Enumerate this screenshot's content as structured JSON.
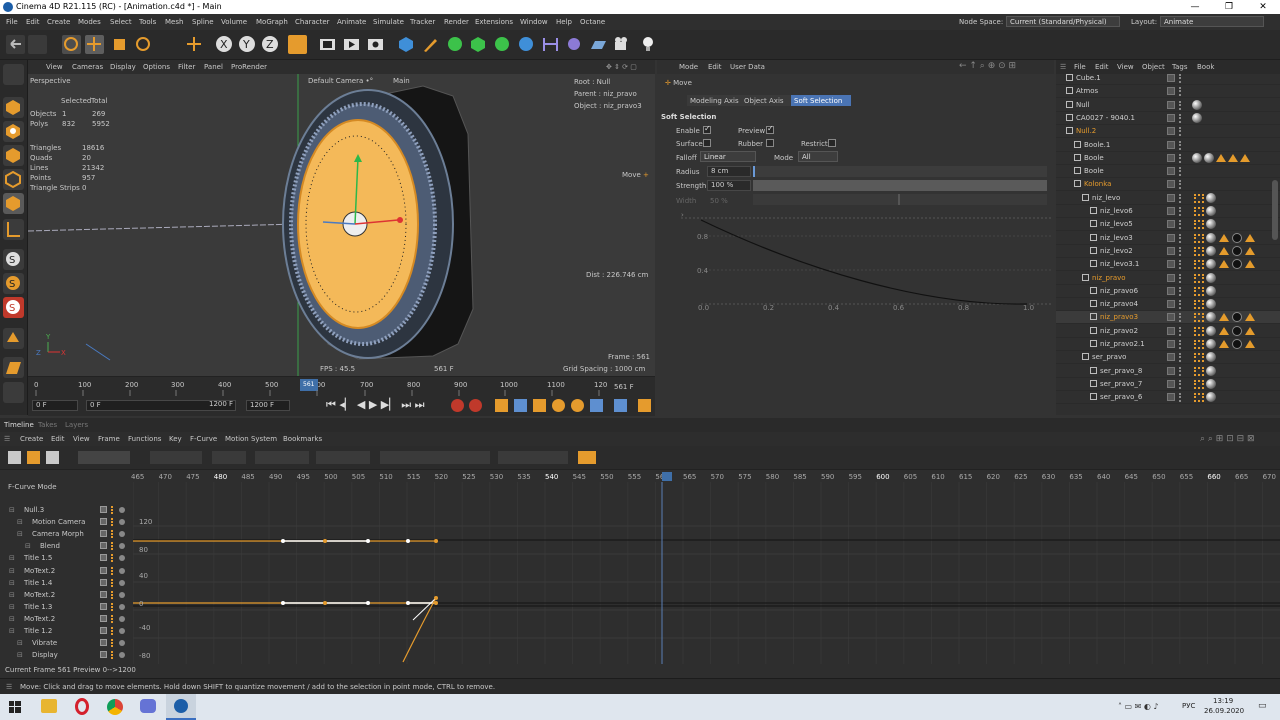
{
  "window": {
    "title": "Cinema 4D R21.115 (RC) - [Animation.c4d *] - Main"
  },
  "menubar": {
    "items": [
      "File",
      "Edit",
      "Create",
      "Modes",
      "Select",
      "Tools",
      "Mesh",
      "Spline",
      "Volume",
      "MoGraph",
      "Character",
      "Animate",
      "Simulate",
      "Tracker",
      "Render",
      "Extensions",
      "Window",
      "Help",
      "Octane"
    ],
    "node_space_label": "Node Space:",
    "node_space_value": "Current (Standard/Physical)",
    "layout_label": "Layout:",
    "layout_value": "Animate"
  },
  "viewport": {
    "menu": [
      "View",
      "Cameras",
      "Display",
      "Options",
      "Filter",
      "Panel",
      "ProRender"
    ],
    "name": "Perspective",
    "camera": "Default Camera",
    "camera_icon": "•°",
    "main": "Main",
    "stats_header": [
      "Selected",
      "Total"
    ],
    "stats": [
      {
        "k": "Objects",
        "a": "1",
        "b": "269"
      },
      {
        "k": "Polys",
        "a": "832",
        "b": "5952"
      }
    ],
    "stats2": [
      {
        "k": "Triangles",
        "v": "18616"
      },
      {
        "k": "Quads",
        "v": "20"
      },
      {
        "k": "Lines",
        "v": "21342"
      },
      {
        "k": "Points",
        "v": "957"
      },
      {
        "k": "Triangle Strips",
        "v": "0"
      }
    ],
    "root": "Root : Null",
    "parent": "Parent : niz_pravo",
    "object": "Object : niz_pravo3",
    "move": "Move",
    "dist": "Dist : 226.746 cm",
    "fps": "FPS : 45.5",
    "frame_mid": "561 F",
    "frame": "Frame : 561",
    "grid": "Grid Spacing : 1000 cm"
  },
  "ruler": {
    "ticks": [
      "0",
      "100",
      "200",
      "300",
      "400",
      "500",
      "600",
      "700",
      "800",
      "900",
      "1000",
      "1100",
      "120"
    ],
    "current": "561 F",
    "cursor": "561"
  },
  "playbar": {
    "start": "0 F",
    "current": "0 F",
    "end": "1200 F",
    "end2": "1200 F"
  },
  "attr": {
    "menu": [
      "Mode",
      "Edit",
      "User Data"
    ],
    "tool": "Move",
    "tabs": [
      "Modeling Axis",
      "Object Axis",
      "Soft Selection"
    ],
    "section": "Soft Selection",
    "enable": "Enable",
    "preview": "Preview",
    "surface": "Surface",
    "rubber": "Rubber",
    "restrict": "Restrict",
    "falloff_label": "Falloff",
    "falloff_value": "Linear",
    "mode_label": "Mode",
    "mode_value": "All",
    "radius_label": "Radius",
    "radius_value": "8 cm",
    "strength_label": "Strength",
    "strength_value": "100 %",
    "width_label": "Width",
    "width_value": "50 %",
    "curve_y": [
      "0.8",
      "0.4"
    ],
    "curve_x": [
      "0.0",
      "0.2",
      "0.4",
      "0.6",
      "0.8",
      "1.0"
    ]
  },
  "objects": {
    "menu": [
      "File",
      "Edit",
      "View",
      "Object",
      "Tags",
      "Book"
    ],
    "rows": [
      {
        "name": "Cube.1",
        "depth": 0
      },
      {
        "name": "Atmos",
        "depth": 0
      },
      {
        "name": "Null",
        "depth": 0
      },
      {
        "name": "CA0027 - 9040.1",
        "depth": 0
      },
      {
        "name": "Null.2",
        "depth": 0,
        "orange": true
      },
      {
        "name": "Boole.1",
        "depth": 1
      },
      {
        "name": "Boole",
        "depth": 1
      },
      {
        "name": "Boole",
        "depth": 1
      },
      {
        "name": "Kolonka",
        "depth": 1,
        "orange": true
      },
      {
        "name": "niz_levo",
        "depth": 2
      },
      {
        "name": "niz_levo6",
        "depth": 3
      },
      {
        "name": "niz_levo5",
        "depth": 3
      },
      {
        "name": "niz_levo3",
        "depth": 3
      },
      {
        "name": "niz_levo2",
        "depth": 3
      },
      {
        "name": "niz_levo3.1",
        "depth": 3
      },
      {
        "name": "niz_pravo",
        "depth": 2,
        "orange": true
      },
      {
        "name": "niz_pravo6",
        "depth": 3
      },
      {
        "name": "niz_pravo4",
        "depth": 3
      },
      {
        "name": "niz_pravo3",
        "depth": 3,
        "orange": true,
        "selected": true
      },
      {
        "name": "niz_pravo2",
        "depth": 3
      },
      {
        "name": "niz_pravo2.1",
        "depth": 3
      },
      {
        "name": "ser_pravo",
        "depth": 2
      },
      {
        "name": "ser_pravo_8",
        "depth": 3
      },
      {
        "name": "ser_pravo_7",
        "depth": 3
      },
      {
        "name": "ser_pravo_6",
        "depth": 3
      }
    ]
  },
  "timeline": {
    "tabs": [
      "Timeline",
      "Takes",
      "Layers"
    ],
    "menu": [
      "Create",
      "Edit",
      "View",
      "Frame",
      "Functions",
      "Key",
      "F-Curve",
      "Motion System",
      "Bookmarks"
    ],
    "mode": "F-Curve Mode",
    "ticks": [
      "465",
      "470",
      "475",
      "480",
      "485",
      "490",
      "495",
      "500",
      "505",
      "510",
      "515",
      "520",
      "525",
      "530",
      "535",
      "540",
      "545",
      "550",
      "555",
      "560",
      "565",
      "570",
      "575",
      "580",
      "585",
      "590",
      "595",
      "600",
      "605",
      "610",
      "615",
      "620",
      "625",
      "630",
      "635",
      "640",
      "645",
      "650",
      "655",
      "660",
      "665",
      "670"
    ],
    "cursor": "561",
    "yvals": [
      "120",
      "80",
      "40",
      "0",
      "-40",
      "-80"
    ],
    "tracks": [
      {
        "name": "Null.3",
        "d": 0
      },
      {
        "name": "Motion Camera",
        "d": 1
      },
      {
        "name": "Camera Morph",
        "d": 1
      },
      {
        "name": "Blend",
        "d": 2
      },
      {
        "name": "Title 1.5",
        "d": 0
      },
      {
        "name": "MoText.2",
        "d": 0
      },
      {
        "name": "Title 1.4",
        "d": 0
      },
      {
        "name": "MoText.2",
        "d": 0
      },
      {
        "name": "Title 1.3",
        "d": 0
      },
      {
        "name": "MoText.2",
        "d": 0
      },
      {
        "name": "Title 1.2",
        "d": 0
      },
      {
        "name": "Vibrate",
        "d": 1
      },
      {
        "name": "Display",
        "d": 1
      }
    ],
    "current_frame": "Current Frame  561  Preview  0-->1200"
  },
  "status": {
    "text": "Move: Click and drag to move elements. Hold down SHIFT to quantize movement / add to the selection in point mode, CTRL to remove."
  },
  "taskbar": {
    "lang": "РУС",
    "time": "13:19",
    "date": "26.09.2020"
  }
}
